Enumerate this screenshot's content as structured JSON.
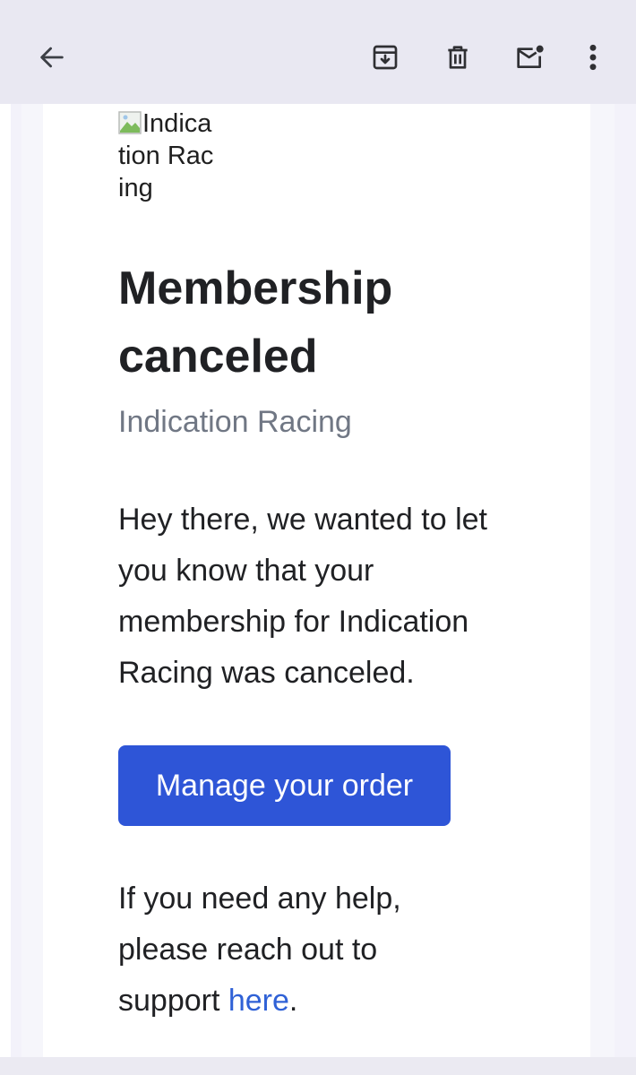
{
  "toolbar": {
    "back_icon": "arrow-left-icon",
    "archive_icon": "archive-icon",
    "delete_icon": "trash-icon",
    "unread_icon": "mark-unread-icon",
    "more_icon": "more-vert-icon"
  },
  "email": {
    "logo_alt": "Indication Racing",
    "title": "Membership canceled",
    "subtitle": "Indication Racing",
    "message": "Hey there, we wanted to let you know that your membership for Indication Racing was canceled.",
    "cta_label": "Manage your order",
    "help_prefix": "If you need any help, please reach out to support ",
    "help_link": "here",
    "help_suffix": "."
  },
  "colors": {
    "accent": "#2e55d7",
    "link": "#2f61d6",
    "subtitle": "#707784",
    "app_bar": "#e9e8f2"
  }
}
